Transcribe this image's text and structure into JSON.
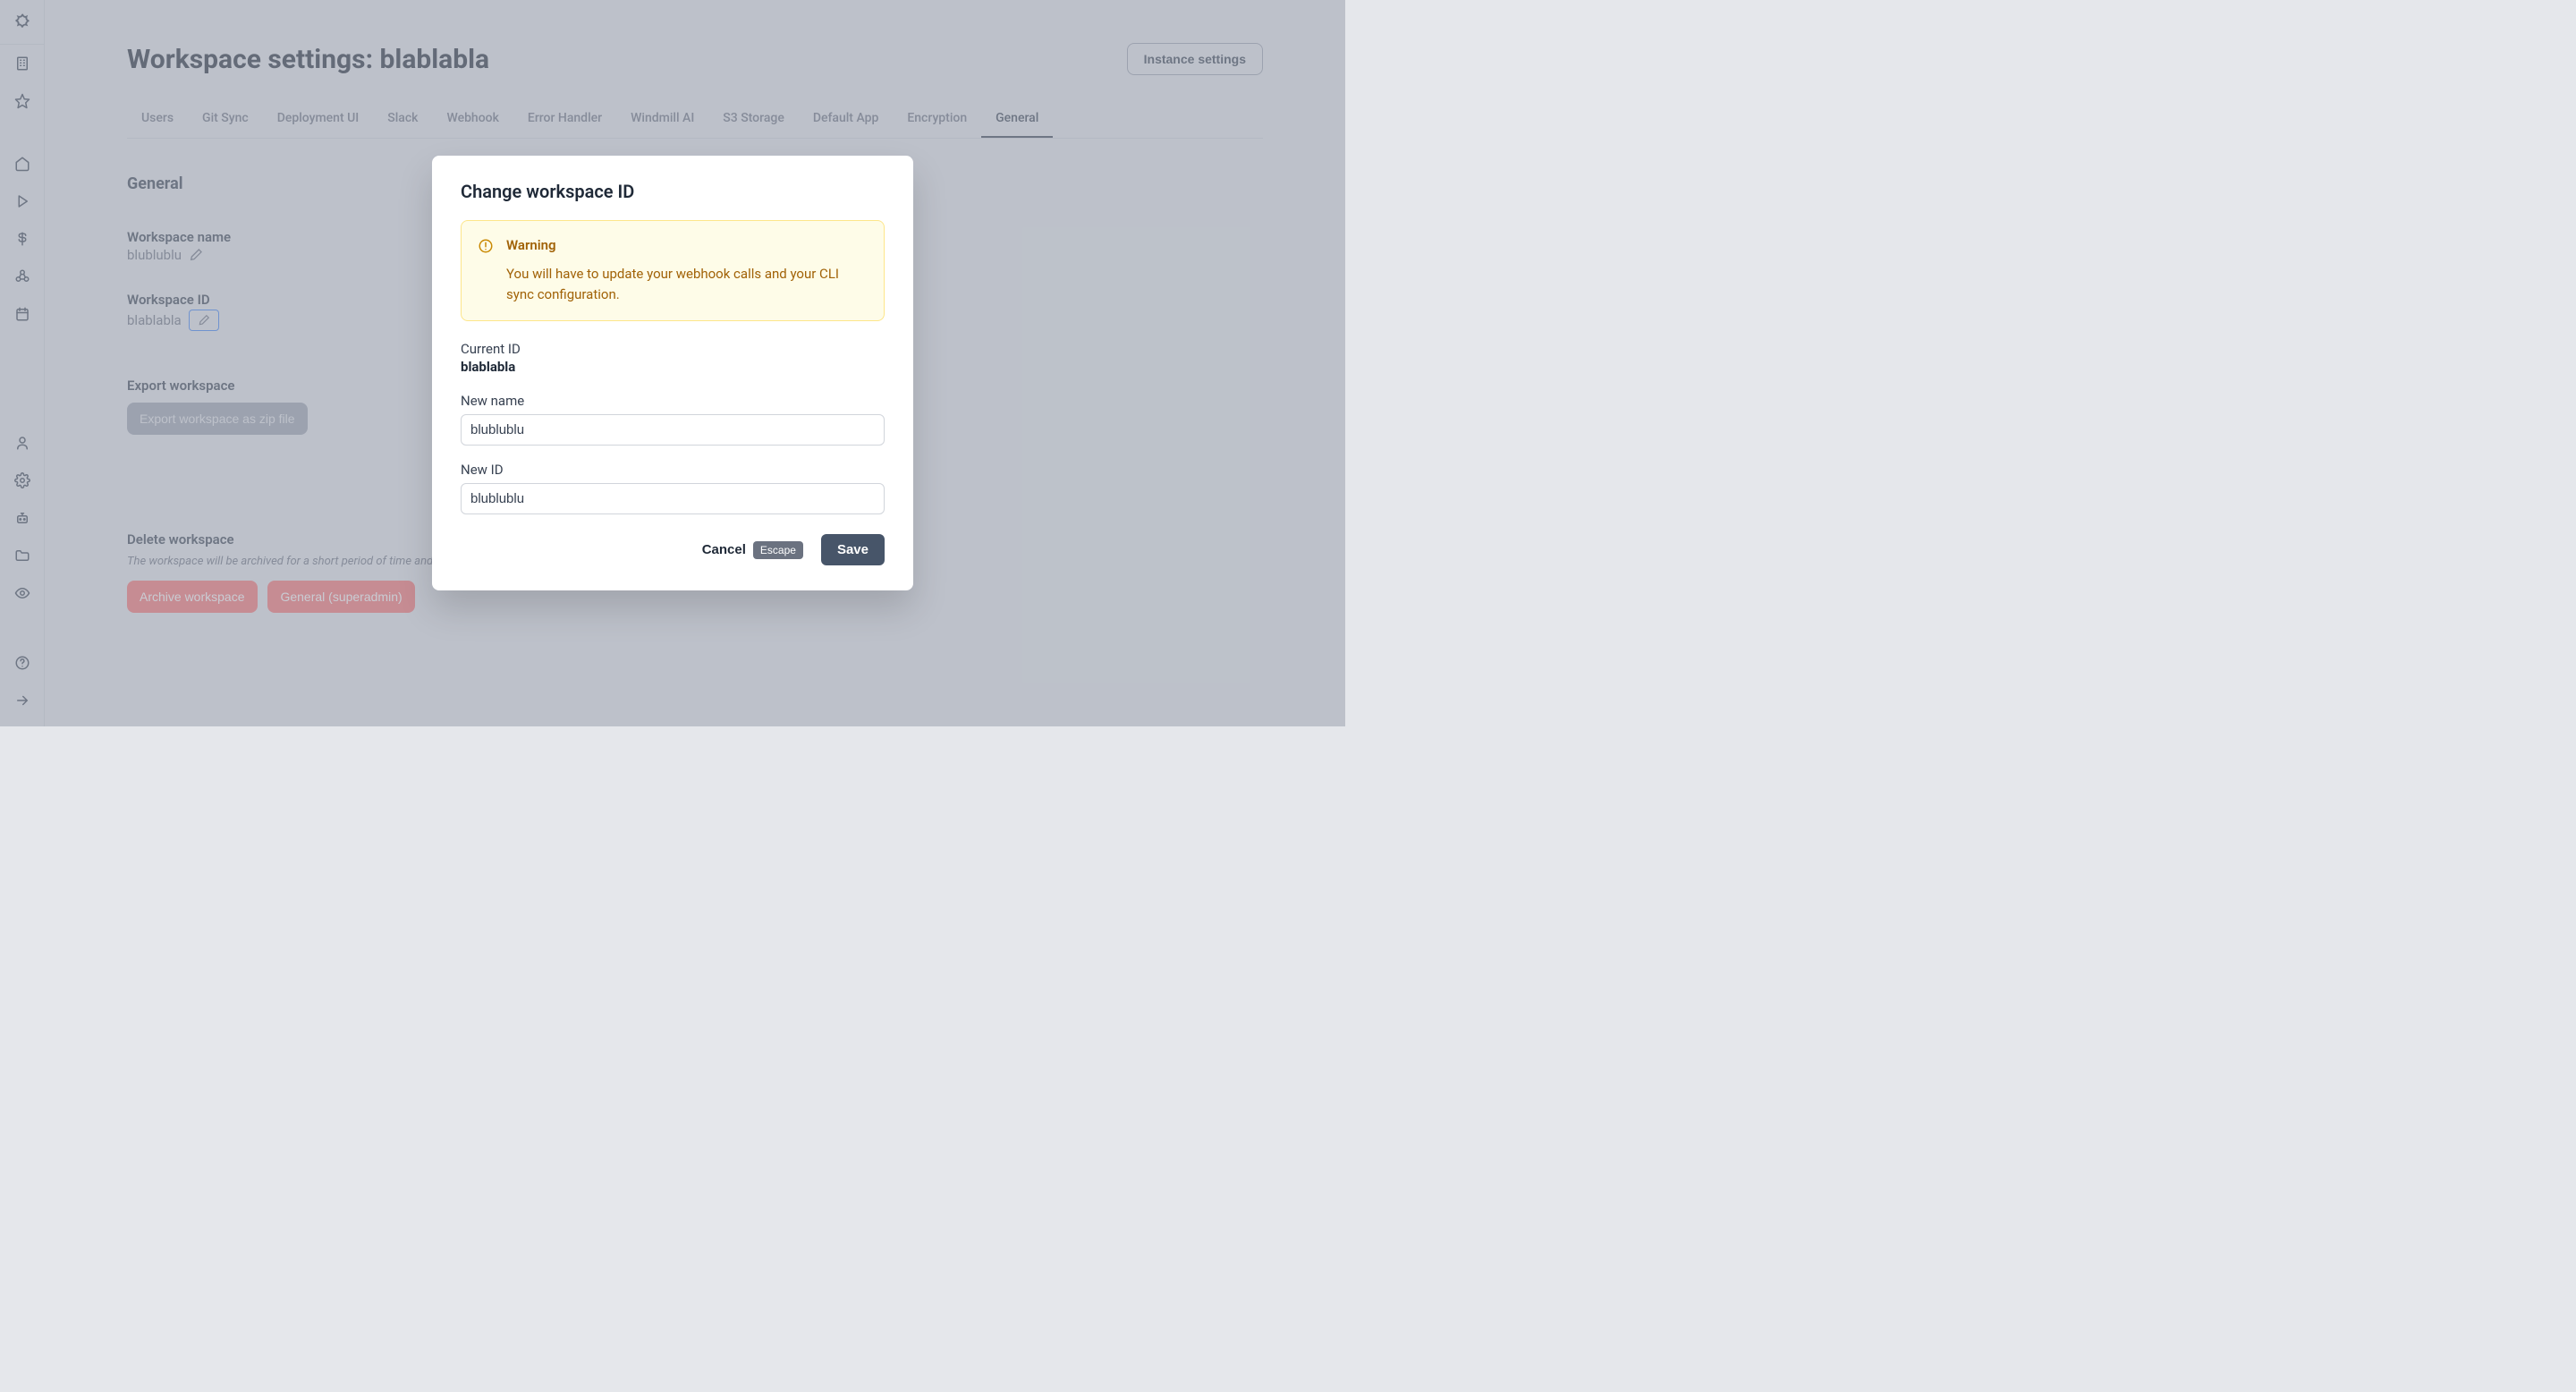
{
  "page": {
    "title_prefix": "Workspace settings: ",
    "title_value": "blablabla",
    "instance_btn": "Instance settings"
  },
  "tabs": [
    "Users",
    "Git Sync",
    "Deployment UI",
    "Slack",
    "Webhook",
    "Error Handler",
    "Windmill AI",
    "S3 Storage",
    "Default App",
    "Encryption",
    "General"
  ],
  "general": {
    "section_title": "General",
    "workspace_name_label": "Workspace name",
    "workspace_name_value": "blublublu",
    "workspace_id_label": "Workspace ID",
    "workspace_id_value": "blablabla",
    "export_label": "Export workspace",
    "export_btn": "Export workspace as zip file",
    "delete_label": "Delete workspace",
    "delete_warning": "The workspace will be archived for a short period of time and then permanently deleted",
    "archive_btn": "Archive workspace",
    "superadmin_btn": "General (superadmin)"
  },
  "modal": {
    "title": "Change workspace ID",
    "warning_title": "Warning",
    "warning_body": "You will have to update your webhook calls and your CLI sync configuration.",
    "current_id_label": "Current ID",
    "current_id_value": "blablabla",
    "new_name_label": "New name",
    "new_name_value": "blublublu",
    "new_id_label": "New ID",
    "new_id_value": "blublublu",
    "cancel_label": "Cancel",
    "escape_hint": "Escape",
    "save_label": "Save"
  }
}
